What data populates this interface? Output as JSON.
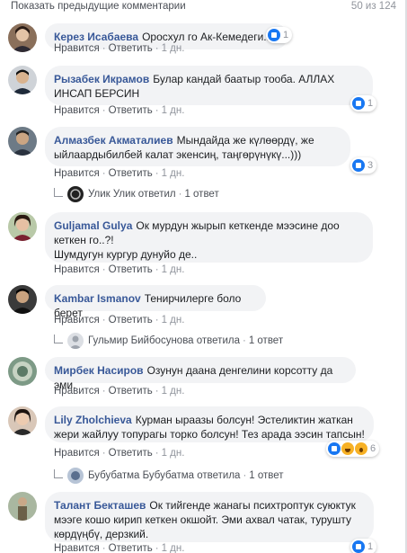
{
  "top": {
    "show_previous": "Показать предыдущие комментарии",
    "count": "50 из 124"
  },
  "actions": {
    "like": "Нравится",
    "reply": "Ответить",
    "dot": "·"
  },
  "comments": [
    {
      "author": "Керез Исабаева",
      "text": "Оросхул го Ак-Кемедеги.....",
      "time": "1 дн.",
      "reactions": "1"
    },
    {
      "author": "Рызабек Икрамов",
      "text": "Булар кандай баатыр тооба. АЛЛАХ ИНСАП БЕРСИН",
      "time": "1 дн.",
      "reactions": "1"
    },
    {
      "author": "Алмазбек Акматалиев",
      "text": "Мындайда же күлөөрдү, же ыйлаардыбилбей калат экенсиң, таңгөрүнүкү...)))",
      "time": "1 дн.",
      "reactions": "3",
      "reply": {
        "name": "Улик Улик ответил",
        "count": "1 ответ"
      }
    },
    {
      "author": "Guljamal Gulya",
      "text": "Ок мурдун жырып кеткенде мээсине доо кеткен го..?!",
      "text2": "Шумдугун кургур дунуйо де..",
      "time": "1 дн."
    },
    {
      "author": "Kambar Ismanov",
      "text": "Тенирчилерге боло берет",
      "time": "1 дн.",
      "reply": {
        "name": "Гульмир Бийбосунова ответила",
        "count": "1 ответ"
      }
    },
    {
      "author": "Мирбек Насиров",
      "text": "Озунун даана денгелини корсотту да эми.",
      "time": "1 дн."
    },
    {
      "author": "Lily Zholchieva",
      "text": "Курман ыраазы болсун! Эстеликтин жаткан жери жайлуу топурагы торко болсун! Тез арада ээсин тапсын!",
      "time": "1 дн.",
      "reactions": "6",
      "reply": {
        "name": "Бубубатма Бубубатма ответила",
        "count": "1 ответ"
      }
    },
    {
      "author": "Талант Бекташев",
      "text": "Ок тийгенде жанагы психтроптук суюктук мээге кошо кирип кеткен окшойт. Эми ахвал чатак, турушту көрдүңбү, дерзкий.",
      "time": "1 дн.",
      "reactions": "1"
    }
  ]
}
